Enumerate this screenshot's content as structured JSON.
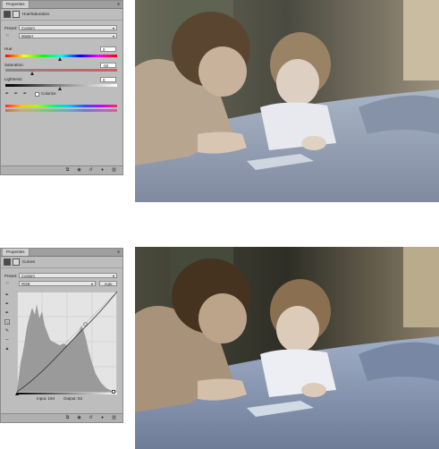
{
  "hue_saturation_panel": {
    "tab_label": "Properties",
    "title": "Hue/Saturation",
    "preset_label": "Preset:",
    "preset_value": "Custom",
    "range_value": "Master",
    "hue_label": "Hue:",
    "hue_value": "0",
    "saturation_label": "Saturation:",
    "saturation_value": "-50",
    "saturation_level": -50,
    "lightness_label": "Lightness:",
    "lightness_value": "0",
    "colorize_label": "Colorize",
    "colorize_checked": false
  },
  "curves_panel": {
    "tab_label": "Properties",
    "title": "Curves",
    "preset_label": "Preset:",
    "preset_value": "Custom",
    "channel_value": "RGB",
    "auto_label": "Auto",
    "input_label": "Input: 194",
    "output_label": "Output: 53"
  },
  "colors": {
    "panel_bg": "#bdbdbd",
    "histogram": "#9a9a9a"
  },
  "icons": [
    "hue-saturation-icon",
    "curves-icon",
    "eyedropper-icon",
    "hand-target-icon",
    "clip-icon",
    "eye-icon",
    "reset-icon",
    "trash-icon"
  ]
}
